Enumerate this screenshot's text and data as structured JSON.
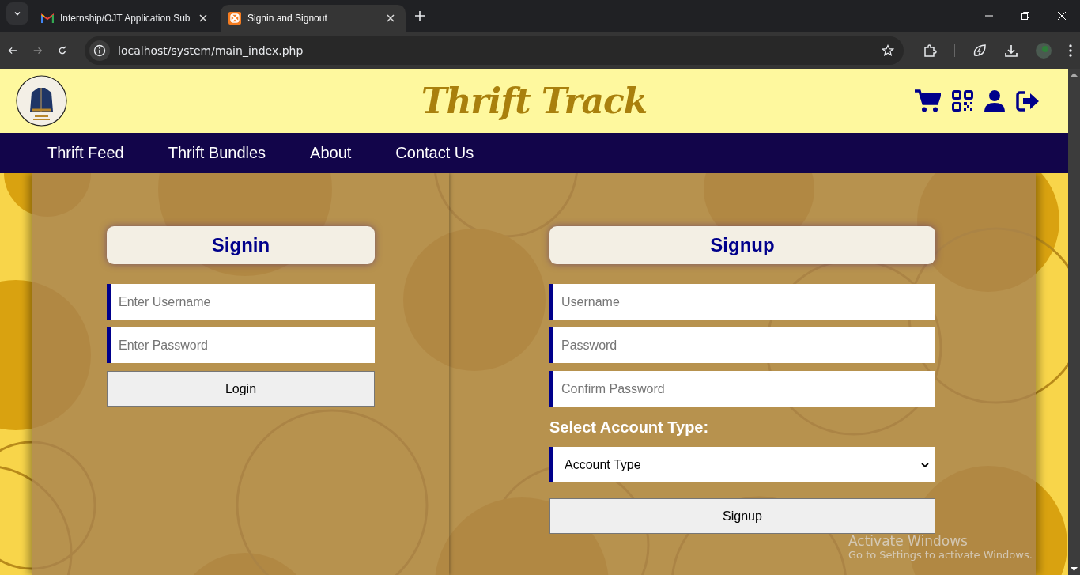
{
  "browser": {
    "tabs": [
      {
        "title": "Internship/OJT Application Sub",
        "kind": "mail",
        "selected": false
      },
      {
        "title": "Signin and Signout",
        "kind": "server",
        "selected": true
      }
    ],
    "url": "localhost/system/main_index.php"
  },
  "header": {
    "site_title": "Thrift Track"
  },
  "nav": {
    "items": [
      "Thrift Feed",
      "Thrift Bundles",
      "About",
      "Contact Us"
    ]
  },
  "signin": {
    "heading": "Signin",
    "fields": [
      {
        "placeholder": "Enter Username"
      },
      {
        "placeholder": "Enter Password"
      }
    ],
    "button": "Login"
  },
  "signup": {
    "heading": "Signup",
    "fields": [
      {
        "placeholder": "Username"
      },
      {
        "placeholder": "Password"
      },
      {
        "placeholder": "Confirm Password"
      }
    ],
    "select_label": "Select Account Type:",
    "select_value": "Account Type",
    "button": "Signup"
  },
  "os_overlay": {
    "title": "Activate Windows",
    "subtitle": "Go to Settings to activate Windows."
  }
}
